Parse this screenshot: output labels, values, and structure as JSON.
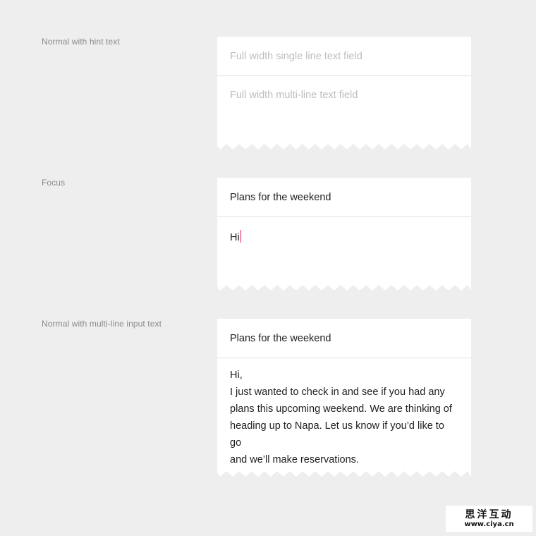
{
  "sections": [
    {
      "label": "Normal with hint text",
      "single_line_hint": "Full width single line text field",
      "multi_line_hint": "Full width multi-line text field"
    },
    {
      "label": "Focus",
      "single_line_value": "Plans for the weekend",
      "multi_line_value": "Hi"
    },
    {
      "label": "Normal with multi-line input text",
      "single_line_value": "Plans for the weekend",
      "multi_line_lines": [
        "Hi,",
        "I just wanted to check in and see if you had any",
        "plans this upcoming weekend. We are thinking of",
        "heading up to Napa. Let us know if you’d like to go",
        "and we’ll make reservations."
      ]
    }
  ],
  "colors": {
    "background": "#eeeeee",
    "field": "#ffffff",
    "hint_text": "#bdbdbd",
    "input_text": "#212121",
    "label_text": "#8a8a8a",
    "cursor": "#e91e63"
  },
  "watermark": {
    "title": "思洋互动",
    "url": "www.ciya.cn"
  }
}
